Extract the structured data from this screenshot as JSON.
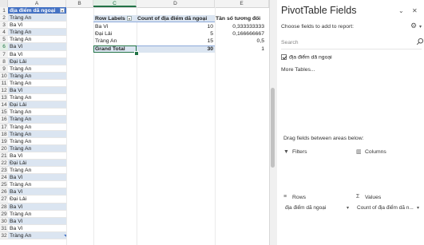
{
  "grid": {
    "columns": [
      "A",
      "B",
      "C",
      "D",
      "E"
    ],
    "active_column": "C",
    "active_row": 6,
    "rows": [
      "1",
      "2",
      "3",
      "4",
      "5",
      "6",
      "7",
      "8",
      "9",
      "10",
      "11",
      "12",
      "13",
      "14",
      "15",
      "16",
      "17",
      "18",
      "19",
      "20",
      "21",
      "22",
      "23",
      "24",
      "25",
      "26",
      "27",
      "28",
      "29",
      "30",
      "31",
      "32"
    ],
    "colA_header": "địa điểm dã ngoại",
    "colA_values": [
      "Tràng An",
      "Ba Vì",
      "Tràng An",
      "Tràng An",
      "Ba Vì",
      "Ba Vì",
      "Đại Lải",
      "Tràng An",
      "Tràng An",
      "Tràng An",
      "Ba Vì",
      "Tràng An",
      "Đại Lải",
      "Tràng An",
      "Tràng An",
      "Tràng An",
      "Tràng An",
      "Tràng An",
      "Tràng An",
      "Ba Vì",
      "Đại Lải",
      "Tràng An",
      "Ba Vì",
      "Tràng An",
      "Ba Vì",
      "Đại Lải",
      "Ba Vì",
      "Tràng An",
      "Ba Vì",
      "Ba Vì",
      "Tràng An"
    ]
  },
  "pivot": {
    "row_labels": "Row Labels",
    "count_header": "Count of địa điểm dã ngoại",
    "ratio_header": "Tần số tương đối",
    "rows": [
      {
        "label": "Ba Vì",
        "count": "10",
        "ratio": "0,333333333"
      },
      {
        "label": "Đại Lải",
        "count": "5",
        "ratio": "0,166666667"
      },
      {
        "label": "Tràng An",
        "count": "15",
        "ratio": "0,5"
      }
    ],
    "grand_total_label": "Grand Total",
    "grand_total_count": "30",
    "grand_total_ratio": "1"
  },
  "pane": {
    "title": "PivotTable Fields",
    "choose_label": "Choose fields to add to report:",
    "search_placeholder": "Search",
    "field_name": "địa điểm dã ngoại",
    "more_tables": "More Tables...",
    "drag_hint": "Drag fields between areas below:",
    "filters_label": "Filters",
    "columns_label": "Columns",
    "rows_label": "Rows",
    "values_label": "Values",
    "rows_item": "địa điểm dã ngoại",
    "values_item": "Count of địa điểm dã n..."
  }
}
